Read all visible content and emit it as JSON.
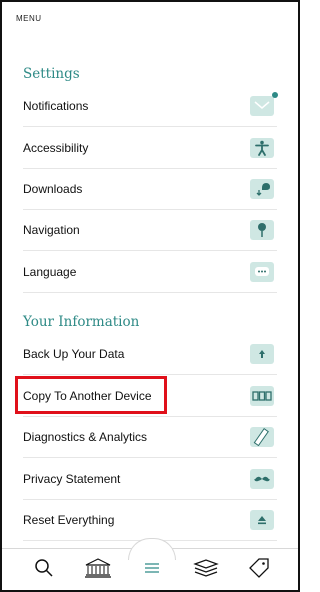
{
  "header": {
    "title": "MENU"
  },
  "settings": {
    "title": "Settings",
    "items": [
      {
        "label": "Notifications",
        "icon": "notification-envelope-icon"
      },
      {
        "label": "Accessibility",
        "icon": "accessibility-person-icon"
      },
      {
        "label": "Downloads",
        "icon": "download-cloud-icon"
      },
      {
        "label": "Navigation",
        "icon": "navigation-pin-icon"
      },
      {
        "label": "Language",
        "icon": "language-chat-icon"
      }
    ]
  },
  "your_information": {
    "title": "Your Information",
    "items": [
      {
        "label": "Back Up Your Data",
        "icon": "upload-arrow-icon"
      },
      {
        "label": "Copy To Another Device",
        "icon": "copy-devices-icon",
        "highlighted": true
      },
      {
        "label": "Diagnostics & Analytics",
        "icon": "ruler-icon"
      },
      {
        "label": "Privacy Statement",
        "icon": "mustache-icon"
      },
      {
        "label": "Reset Everything",
        "icon": "eject-icon"
      }
    ]
  },
  "tabbar": {
    "tabs": [
      {
        "icon": "search-icon",
        "active": false
      },
      {
        "icon": "museum-icon",
        "active": false
      },
      {
        "icon": "menu-icon",
        "active": true
      },
      {
        "icon": "cards-stack-icon",
        "active": false
      },
      {
        "icon": "tag-icon",
        "active": false
      }
    ]
  },
  "colors": {
    "accent": "#2e8a86",
    "icon_bg": "#cfe7e3",
    "highlight": "#e0101a"
  }
}
